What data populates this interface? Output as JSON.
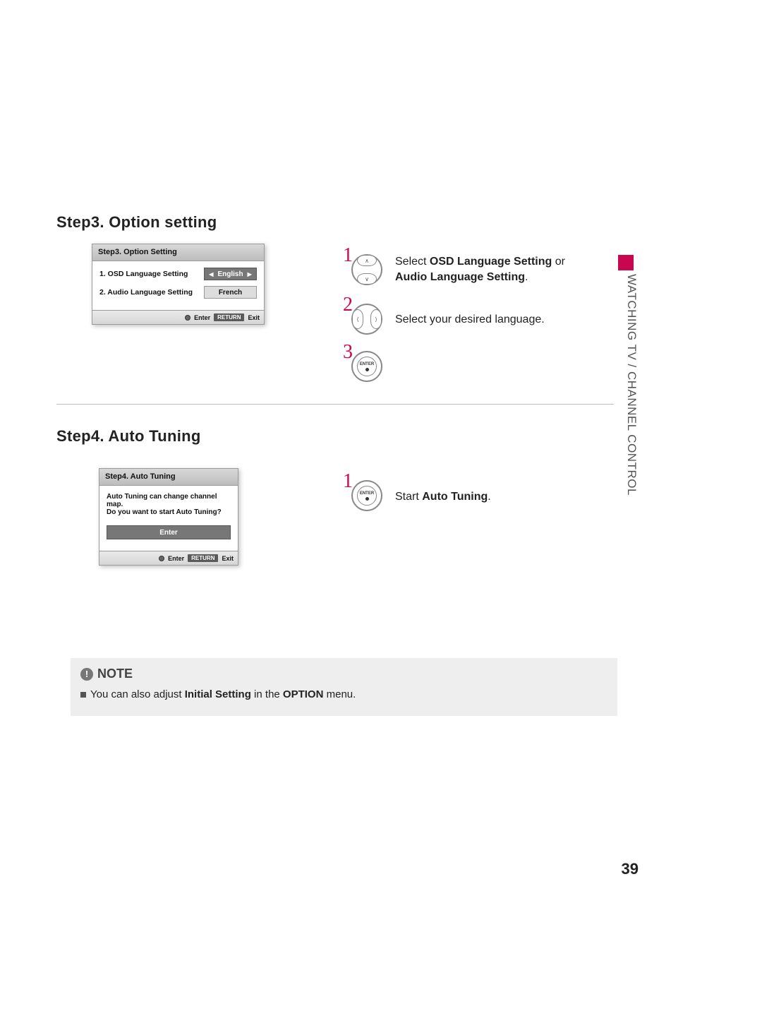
{
  "section_tab_label": "WATCHING TV / CHANNEL CONTROL",
  "page_number": "39",
  "step3": {
    "heading": "Step3. Option setting",
    "panel": {
      "title": "Step3. Option Setting",
      "row1_label": "1. OSD Language Setting",
      "row1_value": "English",
      "row2_label": "2. Audio Language Setting",
      "row2_value": "French",
      "footer_enter": "Enter",
      "footer_return": "RETURN",
      "footer_exit": "Exit"
    },
    "instr1_a": "Select ",
    "instr1_b": "OSD Language Setting",
    "instr1_c": " or",
    "instr1_d": "Audio Language Setting",
    "instr1_e": ".",
    "instr2": "Select your desired language.",
    "num1": "1",
    "num2": "2",
    "num3": "3",
    "enter_label": "ENTER"
  },
  "step4": {
    "heading": "Step4. Auto Tuning",
    "panel": {
      "title": "Step4. Auto Tuning",
      "line1": "Auto Tuning can change channel map.",
      "line2": "Do you want to start Auto Tuning?",
      "enter_btn": "Enter",
      "footer_enter": "Enter",
      "footer_return": "RETURN",
      "footer_exit": "Exit"
    },
    "num1": "1",
    "enter_label": "ENTER",
    "instr_a": "Start ",
    "instr_b": "Auto Tuning",
    "instr_c": "."
  },
  "note": {
    "title": "NOTE",
    "text_a": "You can also adjust ",
    "text_b": "Initial Setting",
    "text_c": " in the ",
    "text_d": "OPTION",
    "text_e": " menu."
  }
}
